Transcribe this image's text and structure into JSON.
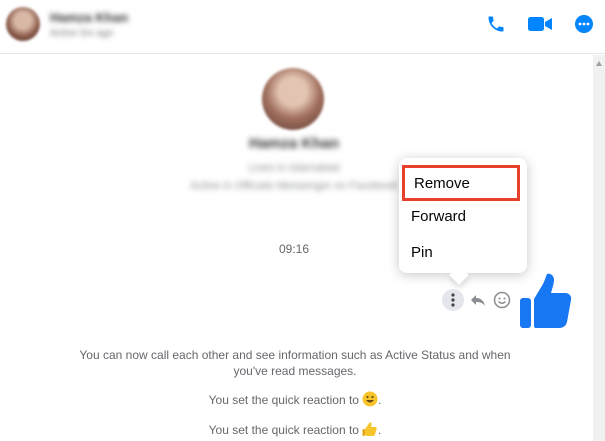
{
  "header": {
    "name": "Hamza Khan",
    "status": "Active 5m ago"
  },
  "profile": {
    "name": "Hamza Khan",
    "line1": "Lives in Islamabad",
    "line2": "Active in Officials Messenger on Facebook"
  },
  "conversation": {
    "timestamp": "09:16",
    "notice_call": "You can now call each other and see information such as Active Status and when you've read messages.",
    "notice_reaction_1": "You set the quick reaction to",
    "notice_reaction_2": "You set the quick reaction to"
  },
  "context_menu": {
    "items": [
      "Remove",
      "Forward",
      "Pin"
    ]
  },
  "icons": {
    "call": "phone-icon",
    "video": "video-camera-icon",
    "info": "more-dots-icon",
    "more": "vertical-dots-icon",
    "reply": "reply-icon",
    "react": "smiley-icon",
    "like": "thumbs-up-icon",
    "emoji_1": "grinning-face-emoji",
    "emoji_2": "thumbs-up-emoji"
  },
  "colors": {
    "accent": "#0084ff",
    "highlight_border": "#e8402b",
    "muted_text": "#65676b"
  }
}
